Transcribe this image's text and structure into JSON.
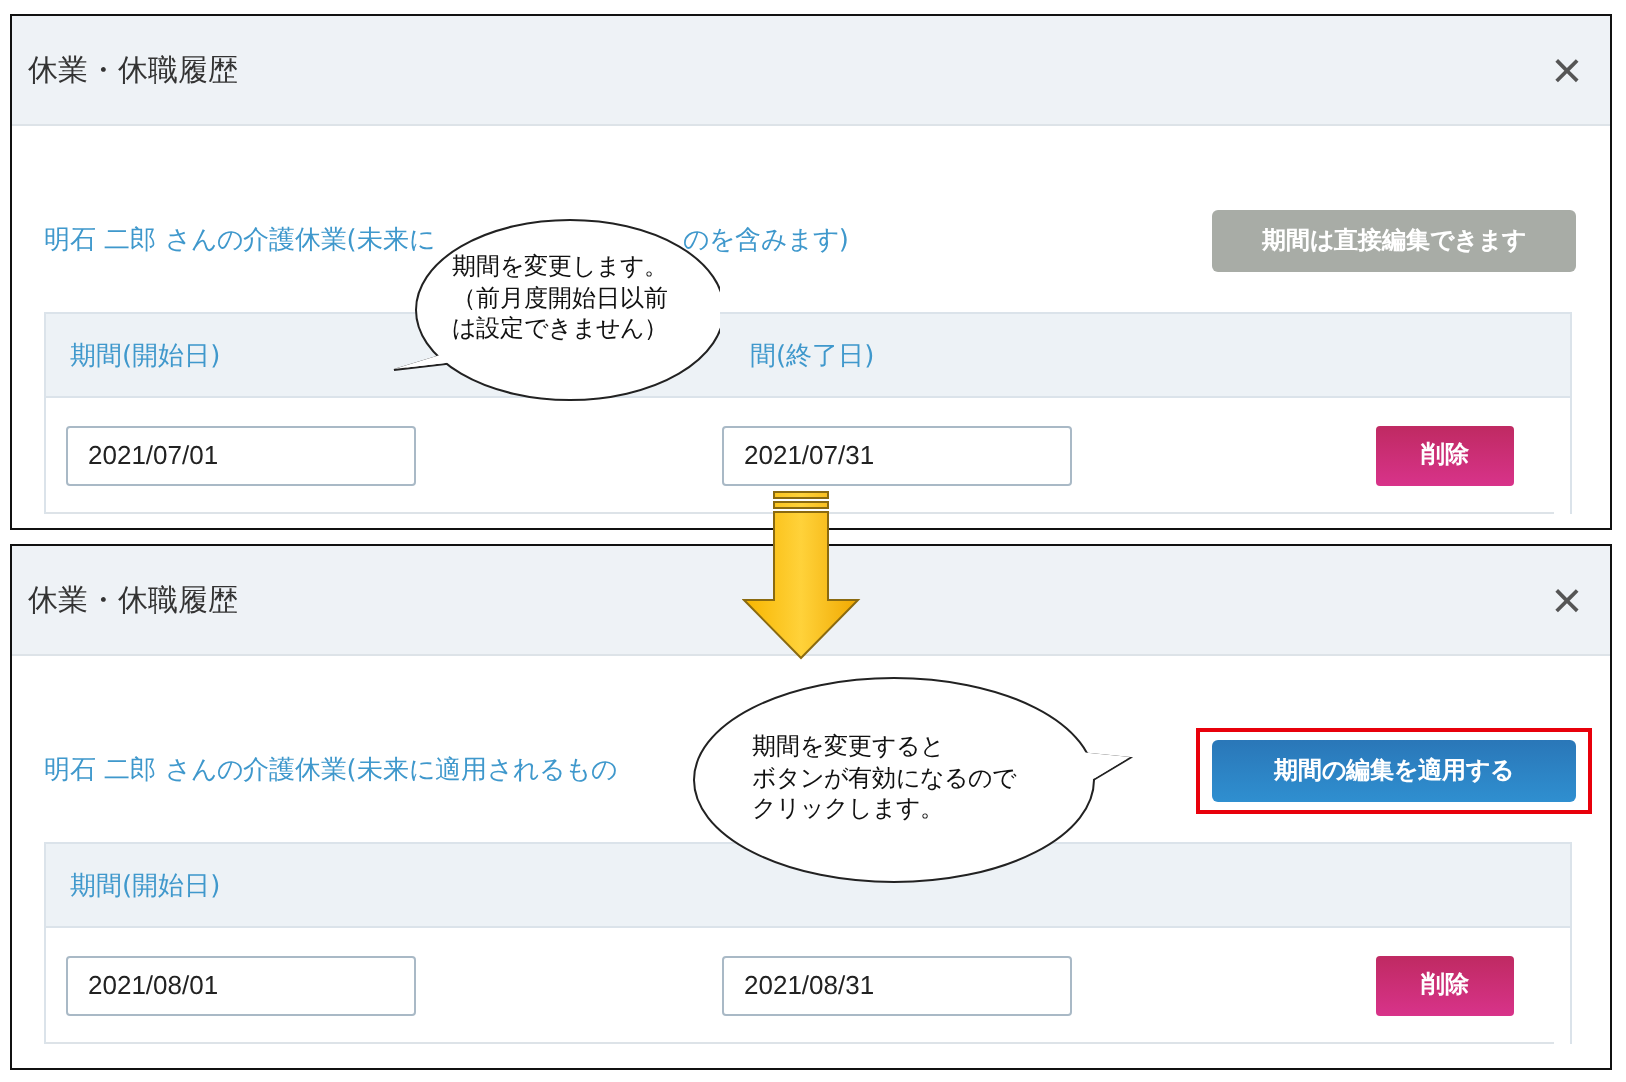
{
  "panels": [
    {
      "title": "休業・休職履歴",
      "close": "×",
      "heading_parts": [
        "明石 二郎 さんの介護休業(未来に",
        "のを含みます)"
      ],
      "action_button": {
        "label": "期間は直接編集できます",
        "disabled": true,
        "highlighted": false
      },
      "columns": [
        "期間(開始日)",
        "間(終了日)"
      ],
      "rows": [
        {
          "start": "2021/07/01",
          "end": "2021/07/31",
          "delete": "削除"
        }
      ]
    },
    {
      "title": "休業・休職履歴",
      "close": "×",
      "heading_parts": [
        "明石 二郎 さんの介護休業(未来に適用されるもの"
      ],
      "action_button": {
        "label": "期間の編集を適用する",
        "disabled": false,
        "highlighted": true
      },
      "columns": [
        "期間(開始日)"
      ],
      "rows": [
        {
          "start": "2021/08/01",
          "end": "2021/08/31",
          "delete": "削除"
        }
      ]
    }
  ],
  "callouts": [
    {
      "lines": [
        "期間を変更します。",
        "（前月度開始日以前",
        "は設定できません）"
      ]
    },
    {
      "lines": [
        "期間を変更すると",
        "ボタンが有効になるので",
        "クリックします。"
      ]
    }
  ]
}
